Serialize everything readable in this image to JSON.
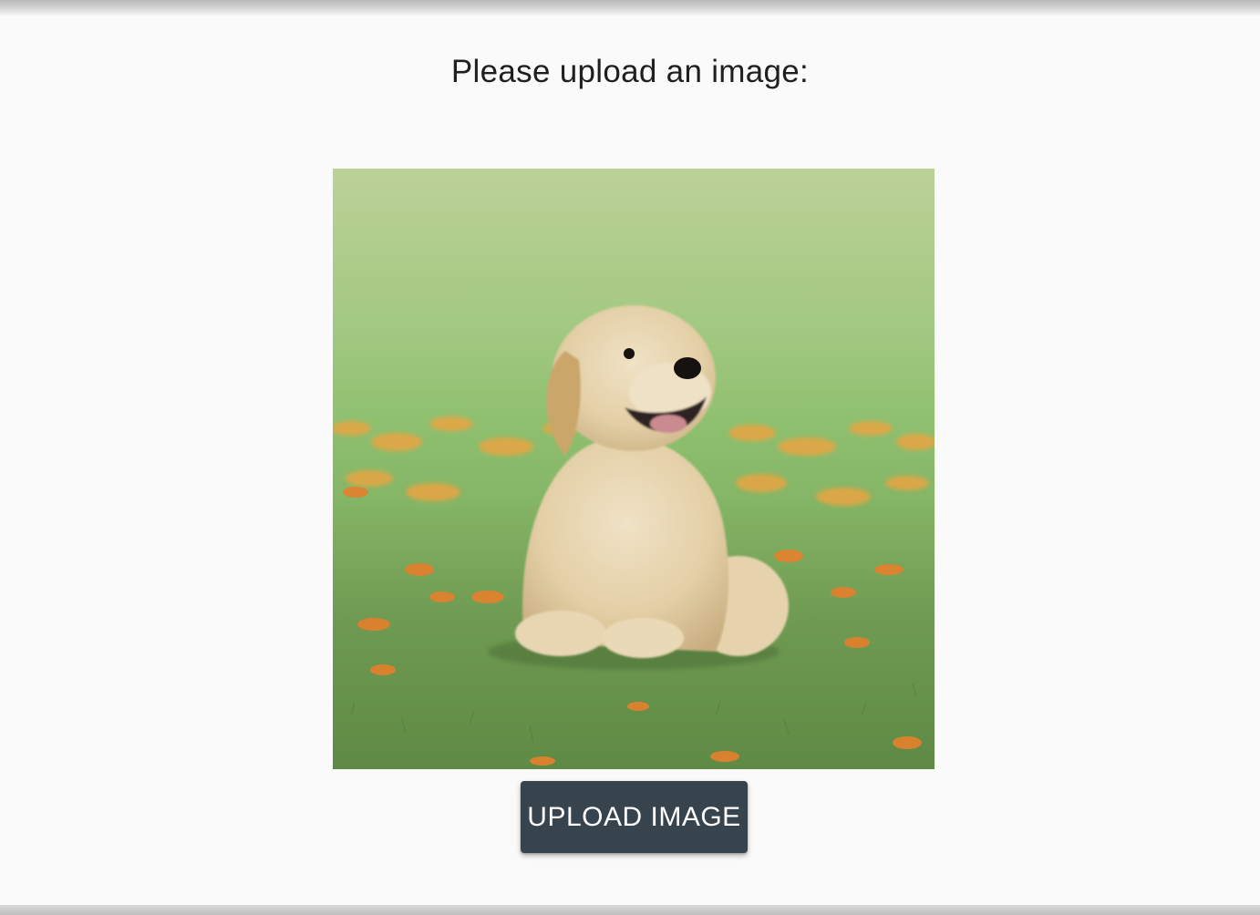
{
  "page": {
    "prompt_text": "Please upload an image:"
  },
  "preview_image": {
    "subject": "puppy sitting in grass with orange petals"
  },
  "upload_button": {
    "label": "UPLOAD IMAGE"
  },
  "colors": {
    "background": "#fafafa",
    "button": "#37434d",
    "button_text": "#ffffff",
    "text": "#1f1f1f"
  }
}
